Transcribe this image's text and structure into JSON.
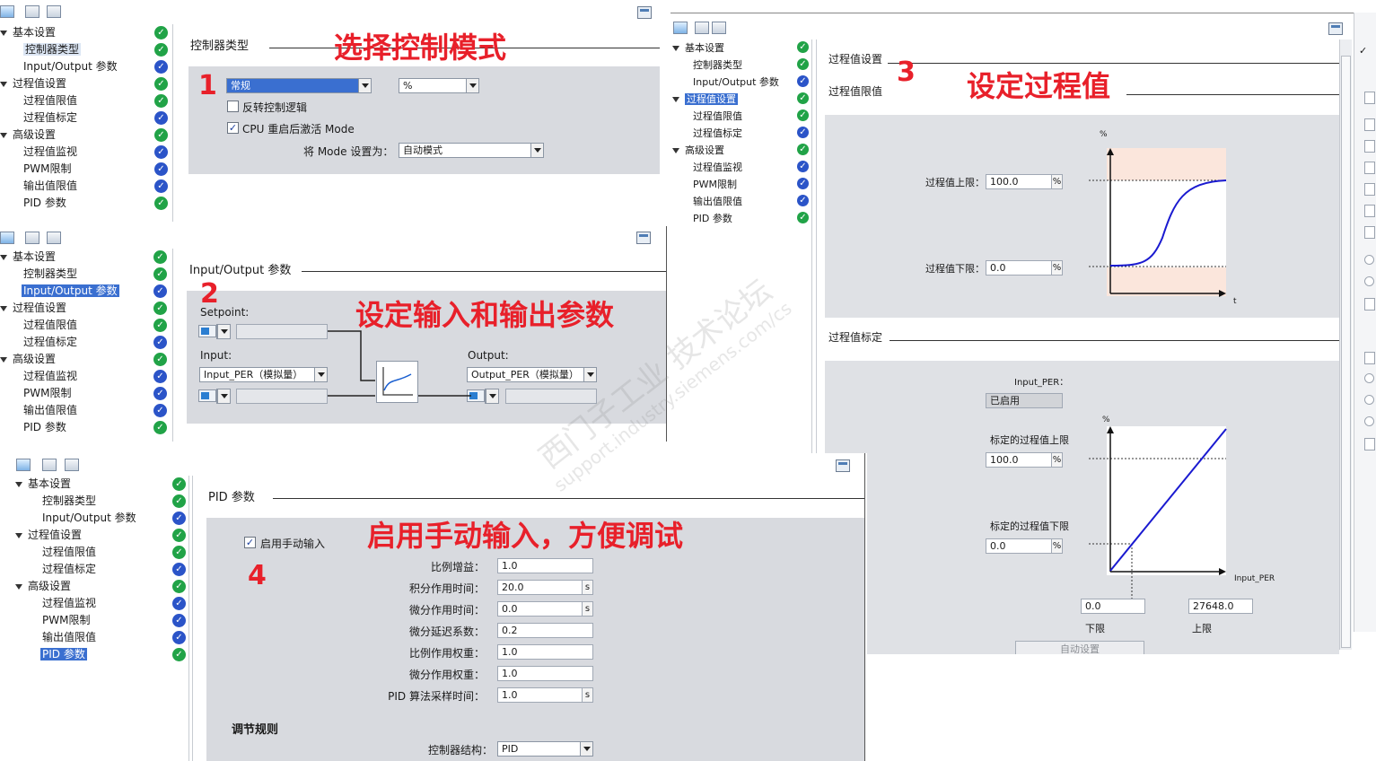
{
  "tree_labels": {
    "basic": "基本设置",
    "ctrl_type": "控制器类型",
    "io": "Input/Output 参数",
    "pv_settings": "过程值设置",
    "pv_limits": "过程值限值",
    "pv_scale": "过程值标定",
    "advanced": "高级设置",
    "pv_monitor": "过程值监视",
    "pwm": "PWM限制",
    "out_limits": "输出值限值",
    "pid_params": "PID 参数"
  },
  "p1": {
    "section": "控制器类型",
    "annotation": "选择控制模式",
    "step": "1",
    "type_value": "常规",
    "unit_value": "%",
    "invert_label": "反转控制逻辑",
    "cpu_label": "CPU 重启后激活 Mode",
    "mode_label": "将 Mode 设置为：",
    "mode_value": "自动模式"
  },
  "p2": {
    "section": "Input/Output 参数",
    "annotation": "设定输入和输出参数",
    "step": "2",
    "setpoint_label": "Setpoint:",
    "input_label": "Input:",
    "input_value": "Input_PER（模拟量）",
    "output_label": "Output:",
    "output_value": "Output_PER（模拟量）"
  },
  "p3": {
    "section": "过程值设置",
    "sub1": "过程值限值",
    "annotation": "设定过程值",
    "step": "3",
    "pct": "%",
    "upper_label": "过程值上限：",
    "upper_value": "100.0",
    "lower_label": "过程值下限：",
    "lower_value": "0.0",
    "t_axis": "t",
    "sub2": "过程值标定",
    "input_per_label": "Input_PER：",
    "input_per_value": "已启用",
    "pct2": "%",
    "scale_hi_label": "标定的过程值上限",
    "scale_hi_value": "100.0",
    "scale_lo_label": "标定的过程值下限",
    "scale_lo_value": "0.0",
    "x_axis": "Input_PER",
    "lo_value": "0.0",
    "hi_value": "27648.0",
    "lo_caption": "下限",
    "hi_caption": "上限",
    "auto_btn": "自动设置",
    "unit_sign": "%"
  },
  "p4": {
    "section": "PID 参数",
    "annotation": "启用手动输入，方便调试",
    "step": "4",
    "manual_label": "启用手动输入",
    "params": [
      {
        "label": "比例增益：",
        "value": "1.0",
        "unit": ""
      },
      {
        "label": "积分作用时间：",
        "value": "20.0",
        "unit": "s"
      },
      {
        "label": "微分作用时间：",
        "value": "0.0",
        "unit": "s"
      },
      {
        "label": "微分延迟系数：",
        "value": "0.2",
        "unit": ""
      },
      {
        "label": "比例作用权重：",
        "value": "1.0",
        "unit": ""
      },
      {
        "label": "微分作用权重：",
        "value": "1.0",
        "unit": ""
      },
      {
        "label": "PID 算法采样时间：",
        "value": "1.0",
        "unit": "s"
      }
    ],
    "rule_heading": "调节规则",
    "structure_label": "控制器结构：",
    "structure_value": "PID"
  },
  "watermark": {
    "line1": "西门子工业  技术论坛",
    "line2": "support.industry.siemens.com/cs"
  },
  "colors": {
    "annotation_red": "#e8202a",
    "check_green": "#21a347",
    "check_blue": "#2b54c8",
    "selection_blue": "#3a6fd0",
    "curve_blue": "#1a1ad0",
    "band_fill": "#fbe6dc"
  }
}
